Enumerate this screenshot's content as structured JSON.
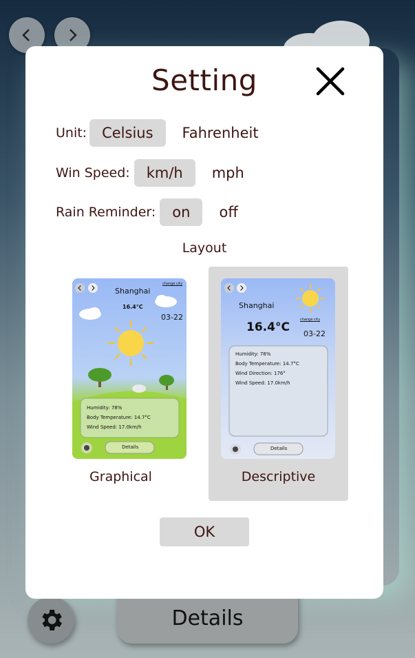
{
  "background": {
    "details_label": "Details"
  },
  "modal": {
    "title": "Setting",
    "unit": {
      "label": "Unit:",
      "options": [
        "Celsius",
        "Fahrenheit"
      ],
      "selected": "Celsius"
    },
    "wind": {
      "label": "Win Speed:",
      "options": [
        "km/h",
        "mph"
      ],
      "selected": "km/h"
    },
    "rain": {
      "label": "Rain Reminder:",
      "options": [
        "on",
        "off"
      ],
      "selected": "on"
    },
    "layout": {
      "title": "Layout",
      "options": [
        "Graphical",
        "Descriptive"
      ],
      "selected": "Descriptive"
    },
    "ok_label": "OK"
  },
  "graphical_preview": {
    "city": "Shanghai",
    "change_city": "change city",
    "temp": "16.4°C",
    "date": "03-22",
    "humidity": "Humidity: 78%",
    "body_temp": "Body Temperature: 14.7°C",
    "wind_speed": "Wind Speed: 17.0km/h",
    "details": "Details"
  },
  "descriptive_preview": {
    "city": "Shanghai",
    "change_city": "change city",
    "temp": "16.4°C",
    "date": "03-22",
    "humidity": "Humidity: 78%",
    "body_temp": "Body Temperature: 14.7°C",
    "wind_dir": "Wind Direction: 176°",
    "wind_speed": "Wind Speed: 17.0km/h",
    "details": "Details"
  },
  "colors": {
    "text": "#3d1512",
    "selected_bg": "#d9d9d9",
    "sky_top": "#9ab9f5",
    "grass": "#9ed43f"
  }
}
